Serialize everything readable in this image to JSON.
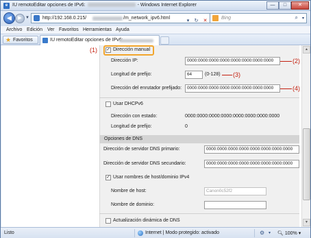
{
  "window": {
    "title": "IU remotoEditar opciones de IPv6:",
    "app_suffix": "- Windows Internet Explorer",
    "buttons": {
      "minimize": "—",
      "maximize": "□",
      "close": "✕"
    }
  },
  "address": {
    "url_prefix": "http://192.168.0.215/",
    "url_suffix": "/m_network_ipv6.html",
    "search_placeholder": "Bing"
  },
  "menu": [
    "Archivo",
    "Edición",
    "Ver",
    "Favoritos",
    "Herramientas",
    "Ayuda"
  ],
  "favorites": {
    "label": "Favoritos"
  },
  "tab": {
    "label": "IU remotoEditar opciones de IPv6:"
  },
  "form": {
    "manual_address": {
      "label": "Dirección manual",
      "checked": true
    },
    "ip_address": {
      "label": "Dirección IP:",
      "value": "0000:0000:0000:0000:0000:0000:0000:0000"
    },
    "prefix_length": {
      "label": "Longitud de prefijo:",
      "value": "64",
      "range": "(0-128)"
    },
    "router_address": {
      "label": "Dirección del enrutador prefijado:",
      "value": "0000:0000:0000:0000:0000:0000:0000:0000"
    },
    "dhcpv6": {
      "label": "Usar DHCPv6",
      "checked": false
    },
    "stateful_address": {
      "label": "Dirección con estado:",
      "value": "0000:0000:0000:0000:0000:0000:0000:0000"
    },
    "stateful_prefix": {
      "label": "Longitud de prefijo:",
      "value": "0"
    },
    "dns_section": {
      "title": "Opciones de DNS"
    },
    "dns_primary": {
      "label": "Dirección de servidor DNS primario:",
      "value": "0000:0000:0000:0000:0000:0000:0000:0000"
    },
    "dns_secondary": {
      "label": "Dirección de servidor DNS secundario:",
      "value": "0000:0000:0000:0000:0000:0000:0000:0000"
    },
    "use_ipv4_host": {
      "label": "Usar nombres de host/dominio IPv4",
      "checked": true
    },
    "host_name": {
      "label": "Nombre de host:",
      "value": "Canon0c52f2"
    },
    "domain_name": {
      "label": "Nombre de dominio:",
      "value": ""
    },
    "dynamic_dns": {
      "label": "Actualización dinámica de DNS",
      "checked": false
    }
  },
  "callouts": [
    "(1)",
    "(2)",
    "(3)",
    "(4)"
  ],
  "status": {
    "text": "Listo",
    "zone": "Internet | Modo protegido: activado",
    "zoom": "100%"
  },
  "colors": {
    "highlight": "#f2a52c",
    "callout": "#c4200f",
    "panel": "#f0f0f0",
    "section_header": "#d4d4d4"
  }
}
